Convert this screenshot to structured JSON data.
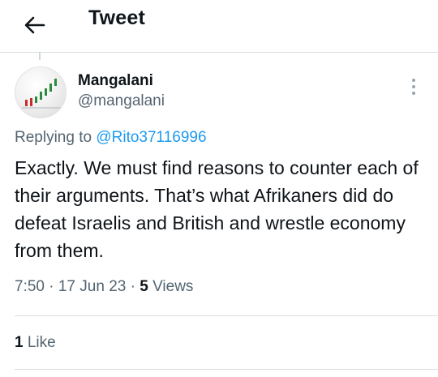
{
  "header": {
    "back_icon": "arrow-left-icon",
    "title": "Tweet"
  },
  "tweet": {
    "author": {
      "display_name": "Mangalani",
      "handle": "@mangalani",
      "avatar_icon": "chart-avatar-icon"
    },
    "more_icon": "vertical-ellipsis-icon",
    "replying_prefix": "Replying to ",
    "replying_to": "@Rito37116996",
    "text": "Exactly. We must find reasons to counter each of their arguments. That’s what Afrikaners did do defeat Israelis and British and wrestle economy from them.",
    "time": "7:50 · 17 Jun 23 · ",
    "views_count": "5",
    "views_label": " Views",
    "likes_count": "1",
    "likes_label": " Like"
  },
  "colors": {
    "text": "#0f1419",
    "secondary": "#536471",
    "link": "#1d9bf0",
    "divider": "#d9dde0"
  }
}
